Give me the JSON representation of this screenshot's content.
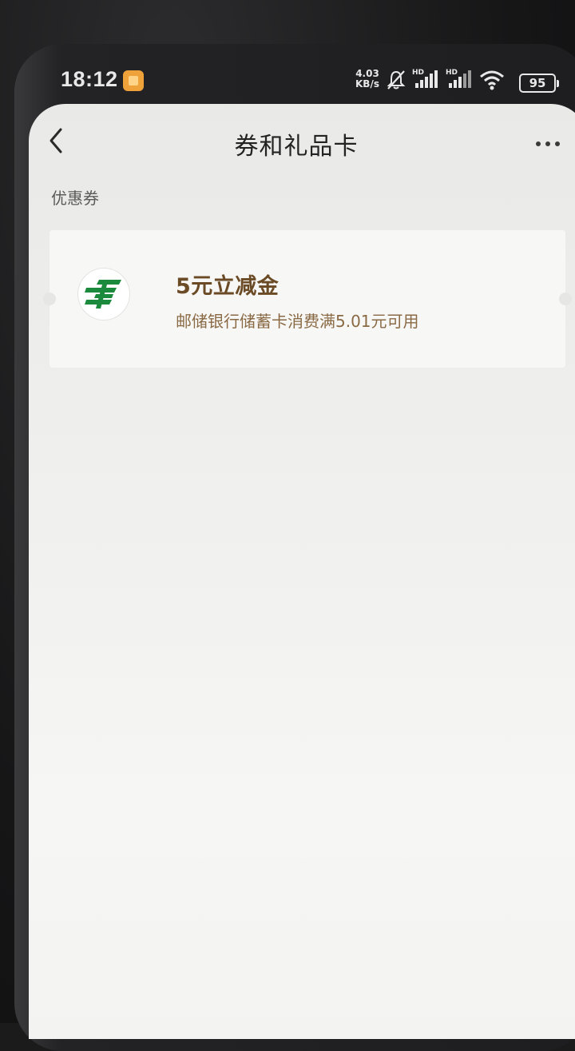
{
  "status_bar": {
    "time": "18:12",
    "net_speed_value": "4.03",
    "net_speed_unit": "KB/s",
    "signal_1_label": "HD",
    "signal_2_label": "HD",
    "battery": "95"
  },
  "header": {
    "title": "券和礼品卡"
  },
  "section": {
    "label": "优惠券"
  },
  "coupons": [
    {
      "title": "5元立减金",
      "description": "邮储银行储蓄卡消费满5.01元可用",
      "icon": "postal-bank-logo-icon"
    }
  ],
  "colors": {
    "coupon_title": "#6b4a26",
    "coupon_desc": "#8a6a45",
    "logo_green": "#1c8a3c"
  }
}
